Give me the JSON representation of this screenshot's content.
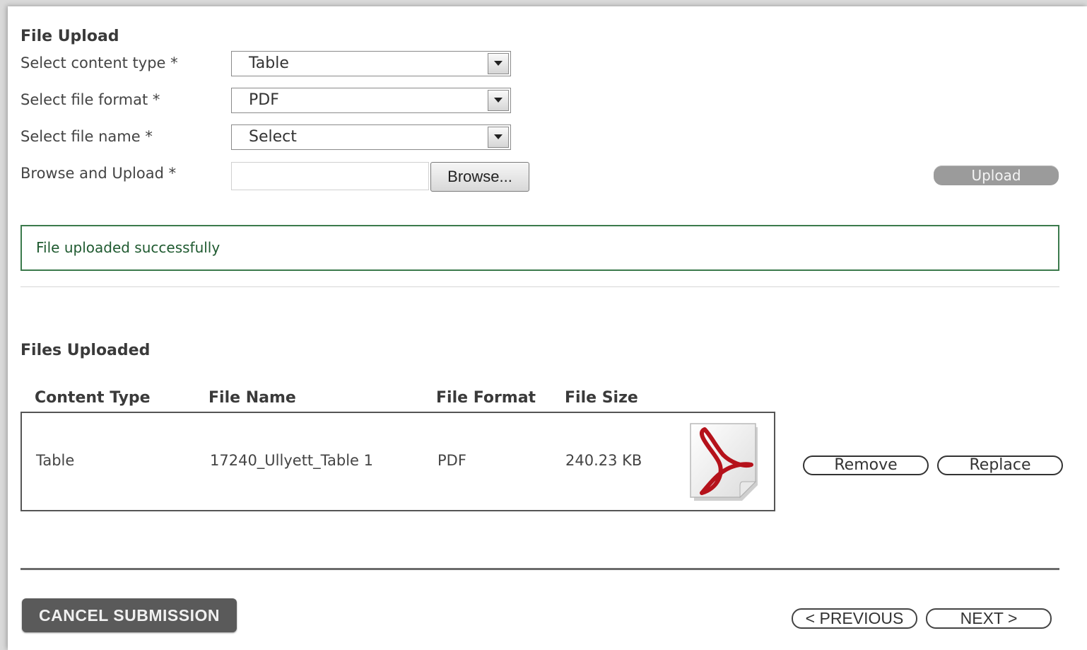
{
  "upload_form": {
    "title": "File Upload",
    "fields": {
      "content_type": {
        "label": "Select content type *",
        "value": "Table"
      },
      "file_format": {
        "label": "Select file format *",
        "value": "PDF"
      },
      "file_name": {
        "label": "Select file name *",
        "value": "Select"
      },
      "browse_upload": {
        "label": "Browse and Upload *",
        "value": ""
      }
    },
    "browse_label": "Browse...",
    "upload_label": "Upload"
  },
  "status": {
    "message": "File uploaded successfully",
    "color": "#1f5a30"
  },
  "files_uploaded": {
    "title": "Files Uploaded",
    "columns": [
      "Content Type",
      "File Name",
      "File Format",
      "File Size"
    ],
    "rows": [
      {
        "content_type": "Table",
        "file_name": "17240_Ullyett_Table 1",
        "file_format": "PDF",
        "file_size": "240.23 KB",
        "icon": "pdf-file-icon",
        "remove_label": "Remove",
        "replace_label": "Replace"
      }
    ]
  },
  "footer": {
    "cancel_label": "CANCEL SUBMISSION",
    "previous_label": "< PREVIOUS",
    "next_label": "NEXT >"
  },
  "colors": {
    "success_border": "#3b7a4c",
    "cancel_bg": "#5a5a5a",
    "upload_bg": "#9b9b9b",
    "pdf_red": "#b5121b"
  }
}
